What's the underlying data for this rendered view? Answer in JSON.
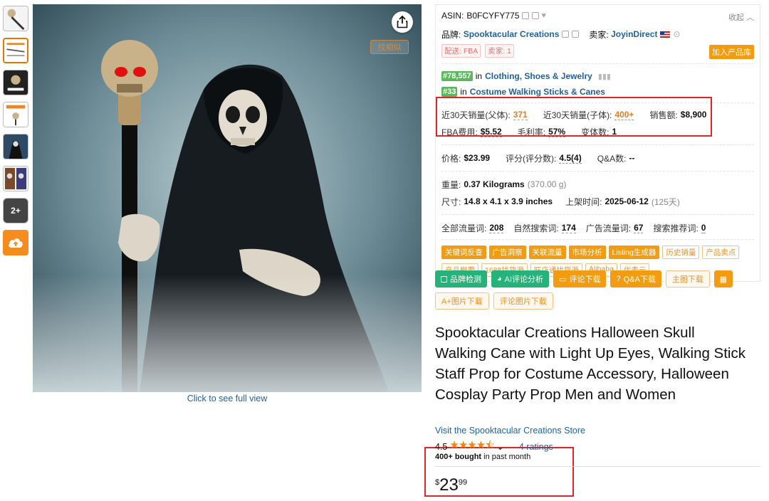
{
  "thumbs": {
    "more_label": "2+"
  },
  "image": {
    "find_similar": "找相似",
    "click_full": "Click to see full view"
  },
  "panel": {
    "asin_label": "ASIN:",
    "asin": "B0FCYFY775",
    "collapse": "收起",
    "brand_label": "品牌:",
    "brand": "Spooktacular Creations",
    "seller_label": "卖家:",
    "seller": "JoyinDirect",
    "ship_tag": "配送: FBA",
    "seller_count_tag": "卖家: 1",
    "add_library": "加入产品库",
    "ranks": [
      {
        "badge": "#78,557",
        "in": "in",
        "category": "Clothing, Shoes & Jewelry"
      },
      {
        "badge": "#33",
        "in": "in",
        "category": "Costume Walking Sticks & Canes"
      }
    ],
    "sales": {
      "parent_label": "近30天销量(父体):",
      "parent_value": "371",
      "child_label": "近30天销量(子体):",
      "child_value": "400+",
      "revenue_label": "销售额:",
      "revenue_value": "$8,900",
      "fba_label": "FBA费用:",
      "fba_value": "$5.52",
      "margin_label": "毛利率:",
      "margin_value": "57%",
      "variants_label": "变体数:",
      "variants_value": "1"
    },
    "price_row": {
      "price_label": "价格:",
      "price_value": "$23.99",
      "rating_label": "评分(评分数):",
      "rating_value": "4.5(4)",
      "qa_label": "Q&A数:",
      "qa_value": "--"
    },
    "weight_label": "重量:",
    "weight_value": "0.37 Kilograms",
    "weight_g": "(370.00 g)",
    "size_label": "尺寸:",
    "size_value": "14.8 x 4.1 x 3.9 inches",
    "listed_label": "上架时间:",
    "listed_value": "2025-06-12",
    "listed_days": "(125天)",
    "keywords": {
      "all_label": "全部流量词:",
      "all_value": "208",
      "natural_label": "自然搜索词:",
      "natural_value": "174",
      "ad_label": "广告流量词:",
      "ad_value": "67",
      "rec_label": "搜索推荐词:",
      "rec_value": "0"
    },
    "tool_tags_filled": [
      "关键词反查",
      "广告洞察",
      "关联流量",
      "市场分析",
      "Listing生成器"
    ],
    "tool_tags_outline": [
      "历史销量",
      "产品卖点",
      "产品概要",
      "1688找货源",
      "旺店通找货源",
      "Alibaba",
      "优麦云"
    ]
  },
  "buttons": {
    "brand_check": "品牌检测",
    "ai_review": "AI评论分析",
    "review_download": "评论下载",
    "qa_download": "Q&A下载",
    "main_img_download": "主图下载",
    "aplus_download": "A+图片下载",
    "review_img_download": "评论图片下载"
  },
  "product": {
    "title": "Spooktacular Creations Halloween Skull Walking Cane with Light Up Eyes, Walking Stick Staff Prop for Costume Accessory, Halloween Cosplay Party Prop Men and Women",
    "store_link": "Visit the Spooktacular Creations Store",
    "rating": "4.5",
    "stars": "★★★★⯪",
    "ratings_count": "4 ratings",
    "bought_bold": "400+ bought",
    "bought_rest": " in past month",
    "price_symbol": "$",
    "price_whole": "23",
    "price_fraction": "99"
  },
  "colors": {
    "accent_orange": "#f39c12",
    "link_blue": "#2162a1",
    "rank_green": "#5cb85c",
    "highlight_red": "#e0242a",
    "button_green": "#26b37a"
  }
}
